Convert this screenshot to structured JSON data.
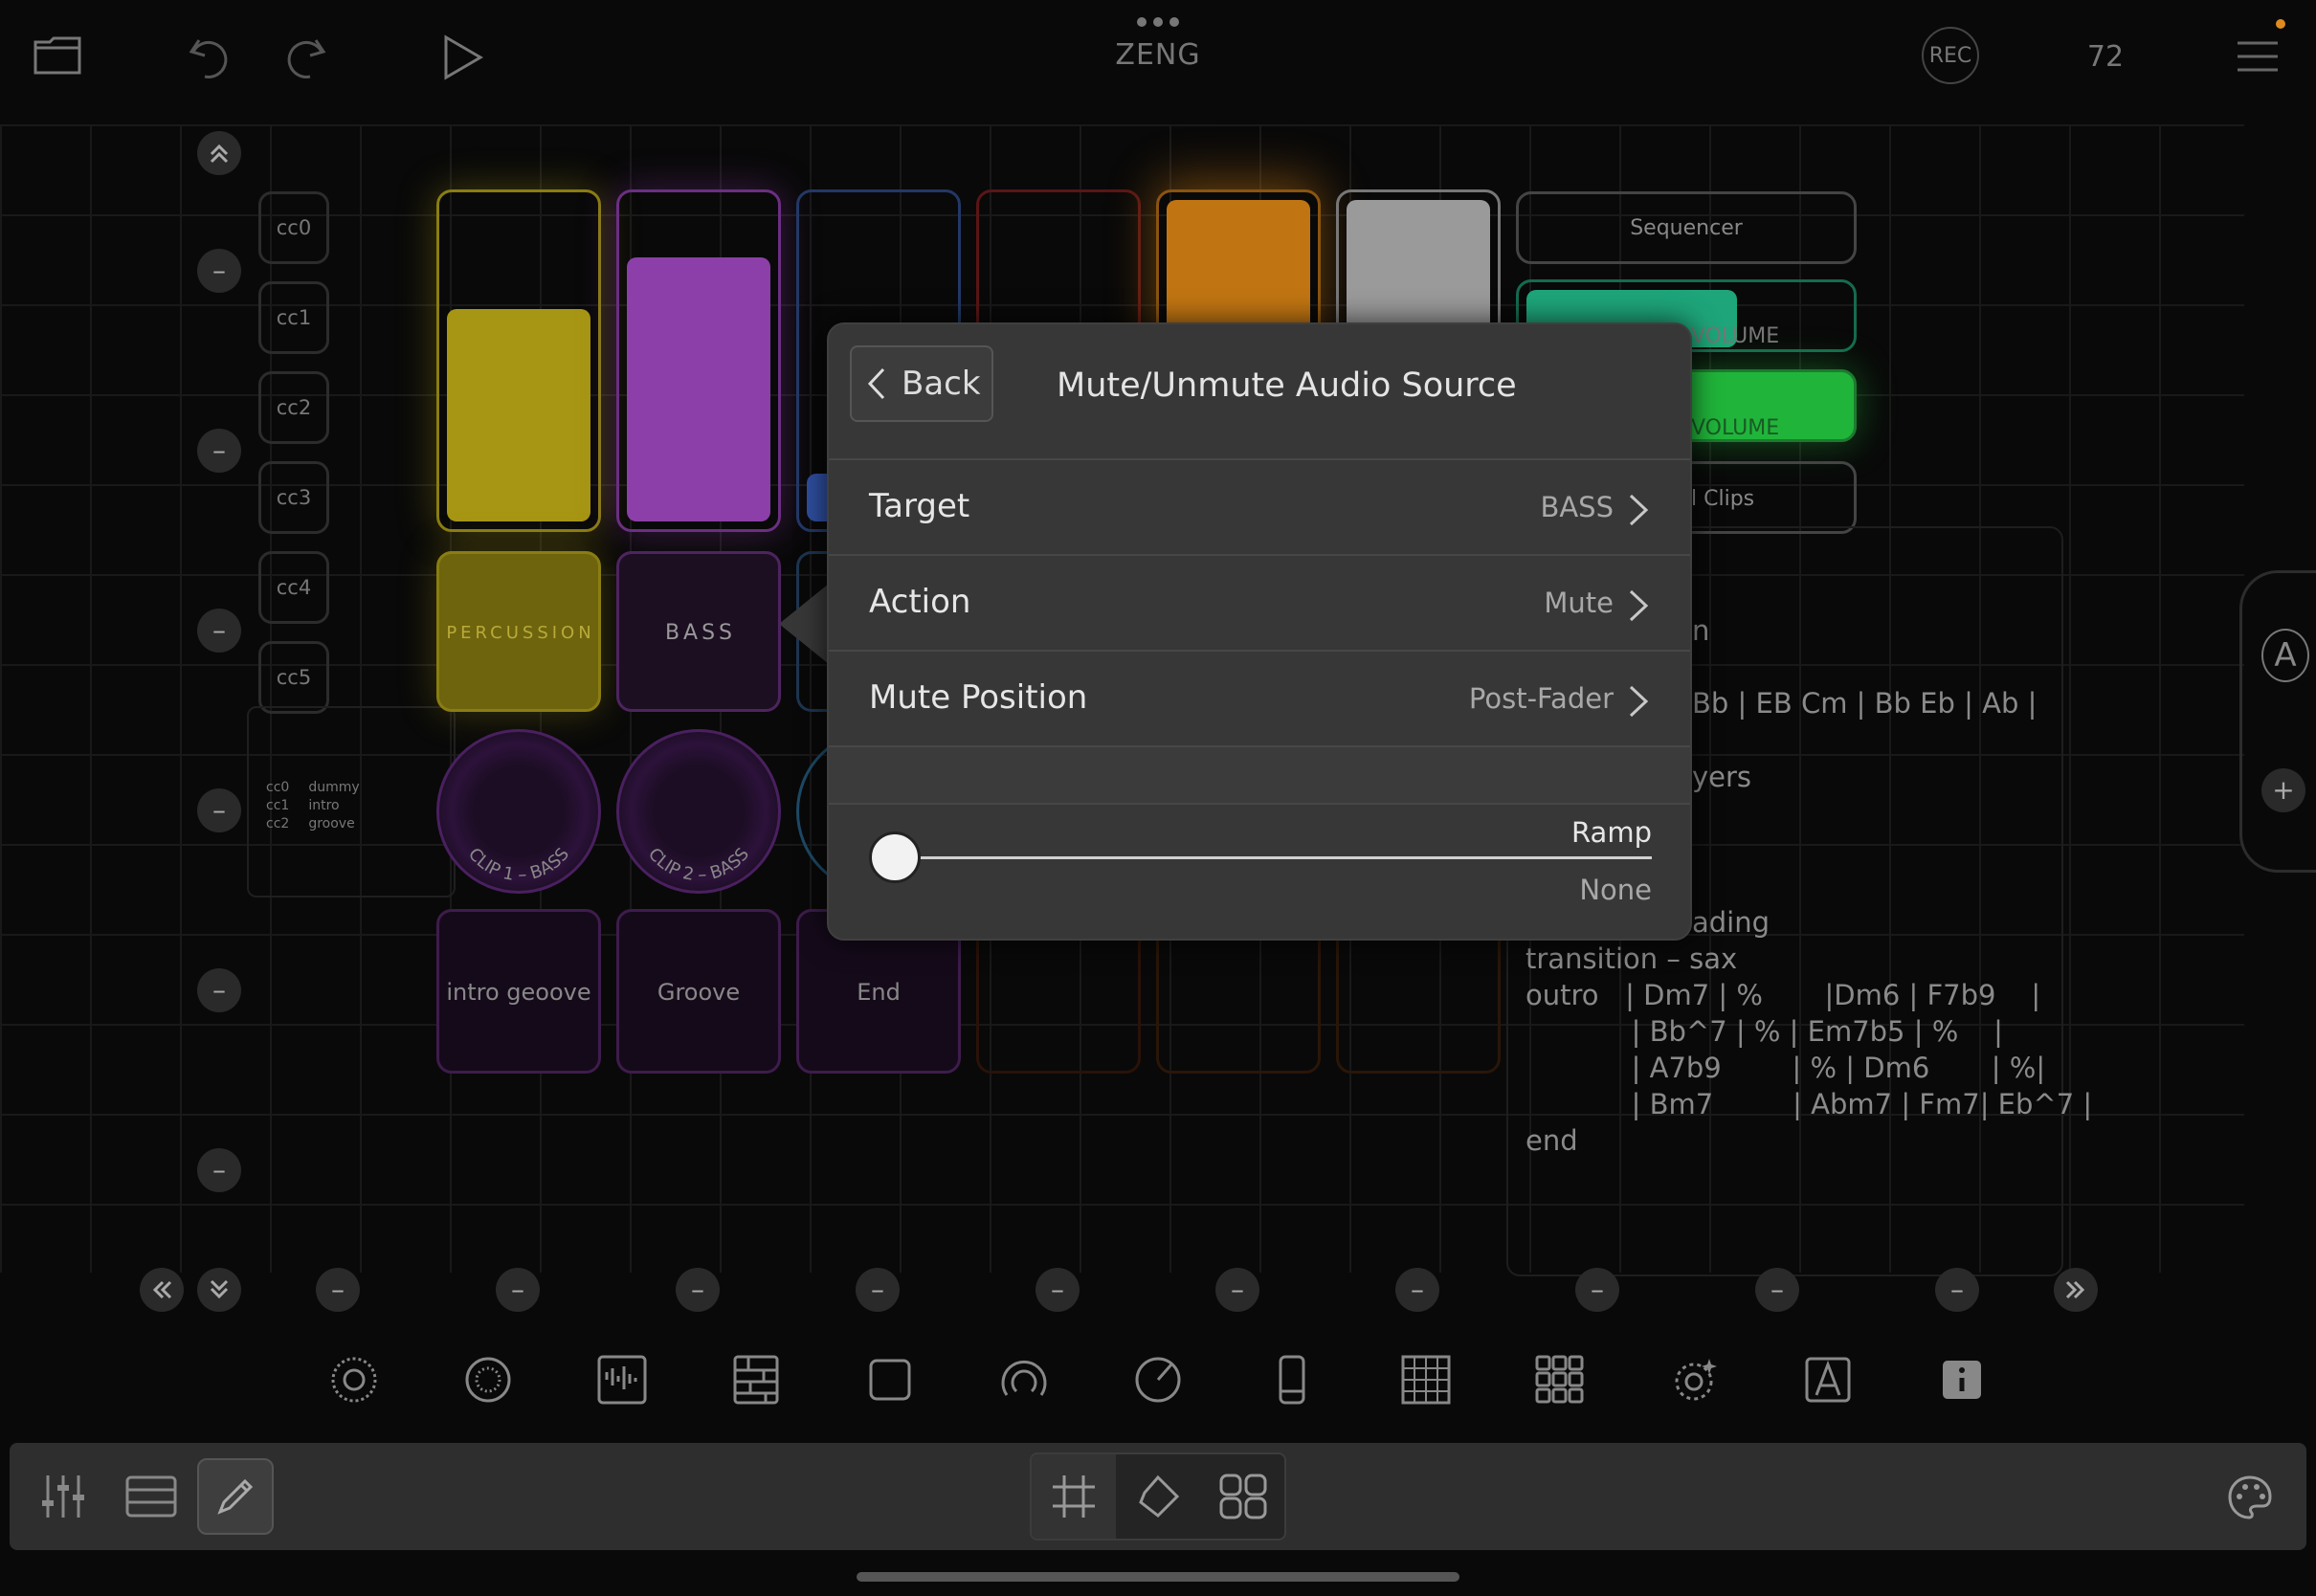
{
  "app": {
    "title": "ZENG",
    "rec_label": "REC",
    "tempo": "72"
  },
  "icons": {
    "folder": "folder-icon",
    "undo": "undo-icon",
    "redo": "redo-icon",
    "play": "play-icon",
    "more": "more-dots-icon",
    "menu": "hamburger-menu-icon"
  },
  "cc_buttons": [
    "cc0",
    "cc1",
    "cc2",
    "cc3",
    "cc4",
    "cc5"
  ],
  "cc_legend": [
    {
      "cc": "cc0",
      "name": "dummy"
    },
    {
      "cc": "cc1",
      "name": "intro"
    },
    {
      "cc": "cc2",
      "name": "groove"
    }
  ],
  "pads": {
    "percussion_label": "PERCUSSION",
    "bass_label": "BASS",
    "clip1": "CLIP 1 – BASS",
    "clip2": "CLIP 2 – BASS",
    "row4": [
      "intro geoove",
      "Groove",
      "End"
    ]
  },
  "right_buttons": {
    "sequencer": "Sequencer",
    "volume1": "VOLUME",
    "volume2": "VOLUME",
    "clips": "l Clips"
  },
  "notes": {
    "lines": [
      "n",
      "Bb | EB Cm | Bb Eb | Ab |",
      "yers",
      "ading",
      "transition – sax",
      "outro   | Dm7 | %       |Dm6 | F7b9    |",
      "            | Bb^7 | % | Em7b5 | %    |",
      "            | A7b9        | % | Dm6       | %|",
      "            | Bm7         | Abm7 | Fm7| Eb^7 |",
      "end"
    ]
  },
  "side_panel": {
    "a_label": "A",
    "plus_label": "+"
  },
  "modal": {
    "back_label": "Back",
    "title": "Mute/Unmute Audio Source",
    "rows": [
      {
        "label": "Target",
        "value": "BASS"
      },
      {
        "label": "Action",
        "value": "Mute"
      },
      {
        "label": "Mute Position",
        "value": "Post-Fader"
      }
    ],
    "ramp": {
      "label": "Ramp",
      "value": "None",
      "position": 0
    }
  },
  "toolbar_icons": [
    "radial-icon",
    "ring-icon",
    "waveform-icon",
    "keyboard-icon",
    "square-icon",
    "knob-arc-icon",
    "dial-icon",
    "phone-icon",
    "grid-icon",
    "multi-pad-icon",
    "sparkle-dial-icon",
    "text-a-icon",
    "info-icon"
  ],
  "bottom_bar": {
    "left": [
      "mixer-icon",
      "list-icon",
      "edit-pencil-icon"
    ],
    "center": [
      "grid-mode-icon",
      "shape-mode-icon",
      "pads-mode-icon"
    ],
    "right": "palette-icon"
  },
  "colors": {
    "yellow": "#b5a414",
    "purple": "#9a45b8",
    "orange": "#d98410",
    "green": "#23c340",
    "teal": "#1fa77a"
  }
}
